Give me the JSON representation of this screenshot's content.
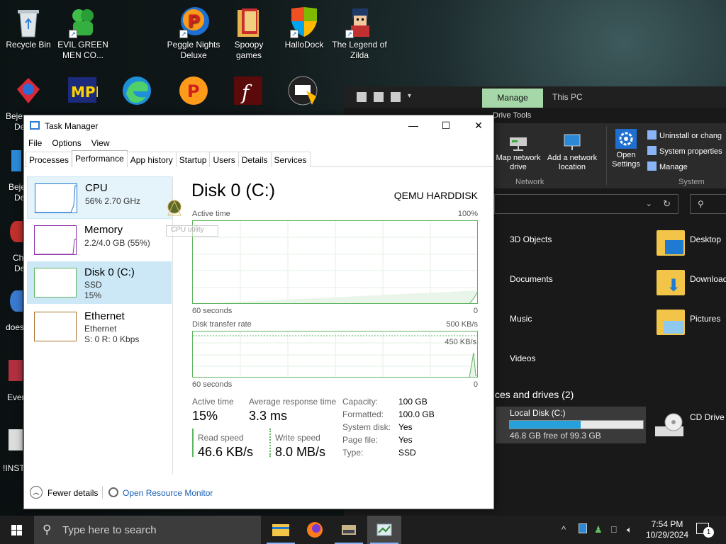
{
  "desktop": {
    "icons": [
      {
        "label": "Recycle Bin"
      },
      {
        "label": "EVIL GREEN MEN CO..."
      },
      {
        "label": "Peggle Nights Deluxe"
      },
      {
        "label": "Spoopy games"
      },
      {
        "label": "HalloDock"
      },
      {
        "label": "The Legend of Zilda"
      }
    ],
    "partial_labels": [
      "Beje",
      "De",
      "Beje",
      "De",
      "Ch",
      "De",
      "does",
      "Ever",
      "!INST"
    ]
  },
  "explorer": {
    "manage_tab": "Manage",
    "title": "This PC",
    "drive_tools": "Drive Tools",
    "ribbon": {
      "map_network_drive": "Map network drive",
      "add_network_location": "Add a network location",
      "network_group": "Network",
      "open_settings": "Open Settings",
      "uninstall": "Uninstall or chang",
      "system_properties": "System properties",
      "manage": "Manage",
      "system_group": "System"
    },
    "folders": [
      "3D Objects",
      "Desktop",
      "Documents",
      "Download",
      "Music",
      "Pictures",
      "Videos"
    ],
    "devices_header": "ces and drives (2)",
    "local_disk": {
      "name": "Local Disk (C:)",
      "free": "46.8 GB free of 99.3 GB",
      "used_fraction": 0.53
    },
    "cd_drive": "CD Drive"
  },
  "task_manager": {
    "title": "Task Manager",
    "menu": [
      "File",
      "Options",
      "View"
    ],
    "tabs": [
      "Processes",
      "Performance",
      "App history",
      "Startup",
      "Users",
      "Details",
      "Services"
    ],
    "active_tab": "Performance",
    "sidebar": [
      {
        "name": "CPU",
        "line2": "56%  2.70 GHz",
        "line3": ""
      },
      {
        "name": "Memory",
        "line2": "2.2/4.0 GB (55%)",
        "line3": ""
      },
      {
        "name": "Disk 0 (C:)",
        "line2": "SSD",
        "line3": "15%"
      },
      {
        "name": "Ethernet",
        "line2": "Ethernet",
        "line3": "S: 0  R: 0 Kbps"
      }
    ],
    "detail": {
      "title": "Disk 0 (C:)",
      "model": "QEMU HARDDISK",
      "active_time_label": "Active time",
      "active_time_max": "100%",
      "seconds_label_1": "60 seconds",
      "zero_1": "0",
      "transfer_label": "Disk transfer rate",
      "transfer_max": "500 KB/s",
      "transfer_mid": "450 KB/s",
      "seconds_label_2": "60 seconds",
      "zero_2": "0",
      "stats": {
        "active_time_label": "Active time",
        "active_time_value": "15%",
        "avg_resp_label": "Average response time",
        "avg_resp_value": "3.3 ms",
        "read_label": "Read speed",
        "read_value": "46.6 KB/s",
        "write_label": "Write speed",
        "write_value": "8.0 MB/s"
      },
      "properties": [
        {
          "k": "Capacity:",
          "v": "100 GB"
        },
        {
          "k": "Formatted:",
          "v": "100.0 GB"
        },
        {
          "k": "System disk:",
          "v": "Yes"
        },
        {
          "k": "Page file:",
          "v": "Yes"
        },
        {
          "k": "Type:",
          "v": "SSD"
        }
      ]
    },
    "footer": {
      "fewer_details": "Fewer details",
      "open_resource_monitor": "Open Resource Monitor"
    },
    "ghost_text": "CPU utility"
  },
  "taskbar": {
    "search_placeholder": "Type here to search",
    "time": "7:54 PM",
    "date": "10/29/2024",
    "notification_count": "1"
  },
  "colors": {
    "disk_green": "#5fb45f",
    "cpu_blue": "#1f7ad1",
    "memory_purple": "#8b2fa8",
    "ethernet_orange": "#a86f2c",
    "selection": "#cce8f6",
    "link": "#1a5fb4"
  }
}
